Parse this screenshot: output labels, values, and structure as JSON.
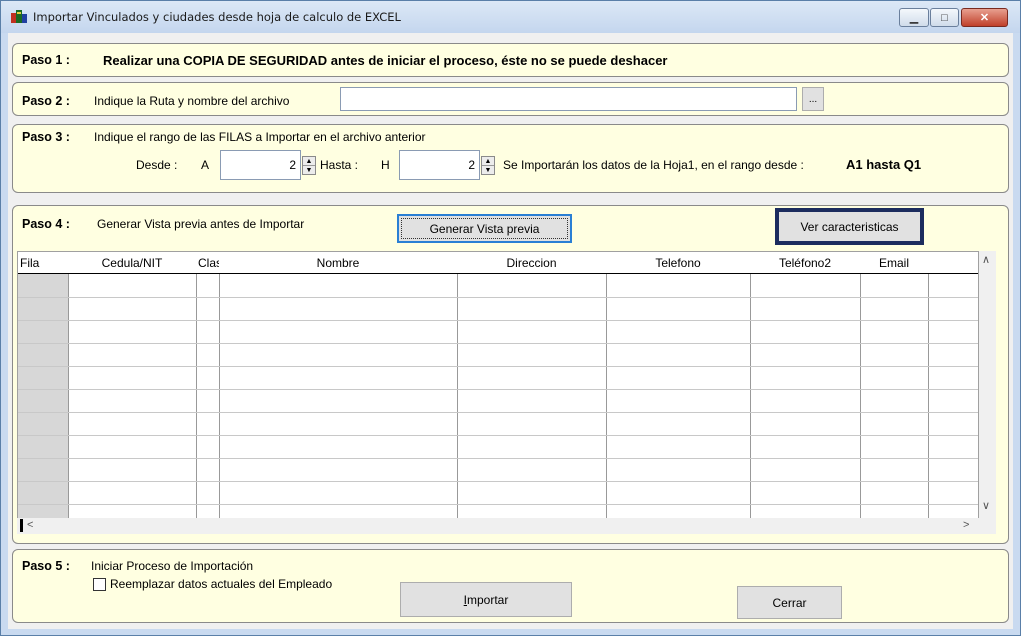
{
  "window": {
    "title": "Importar Vinculados y ciudades desde hoja de calculo de EXCEL",
    "minimize": "▁",
    "maximize": "□",
    "close": "✕"
  },
  "paso1": {
    "label": "Paso 1 :",
    "text": "Realizar una COPIA DE SEGURIDAD antes de iniciar el proceso, éste no se puede deshacer"
  },
  "paso2": {
    "label": "Paso 2 :",
    "text": "Indique la Ruta y nombre del archivo",
    "path_value": "",
    "browse_label": "..."
  },
  "paso3": {
    "label": "Paso 3 :",
    "text": "Indique el rango de las FILAS a Importar en el archivo anterior",
    "desde_label": "Desde :",
    "desde_col": "A",
    "desde_value": "2",
    "hasta_label": "Hasta :",
    "hasta_col": "H",
    "hasta_value": "2",
    "info_text": "Se Importarán los datos de la Hoja1,  en el rango desde :",
    "range_text": "A1 hasta Q1"
  },
  "paso4": {
    "label": "Paso 4 :",
    "text": "Generar Vista previa antes de Importar",
    "preview_button": "Generar Vista previa",
    "features_button": "Ver caracteristicas",
    "columns": [
      "Fila",
      "Cedula/NIT",
      "Clas",
      "Nombre",
      "Direccion",
      "Telefono",
      "Teléfono2",
      "Email"
    ]
  },
  "paso5": {
    "label": "Paso 5 :",
    "text": "Iniciar Proceso de Importación",
    "checkbox_label": "Reemplazar datos actuales del Empleado",
    "import_accel": "I",
    "import_rest": "mportar",
    "close_button": "Cerrar"
  },
  "colors": {
    "panel_bg": "#ffffe1",
    "focus_border": "#1c2c5e"
  }
}
